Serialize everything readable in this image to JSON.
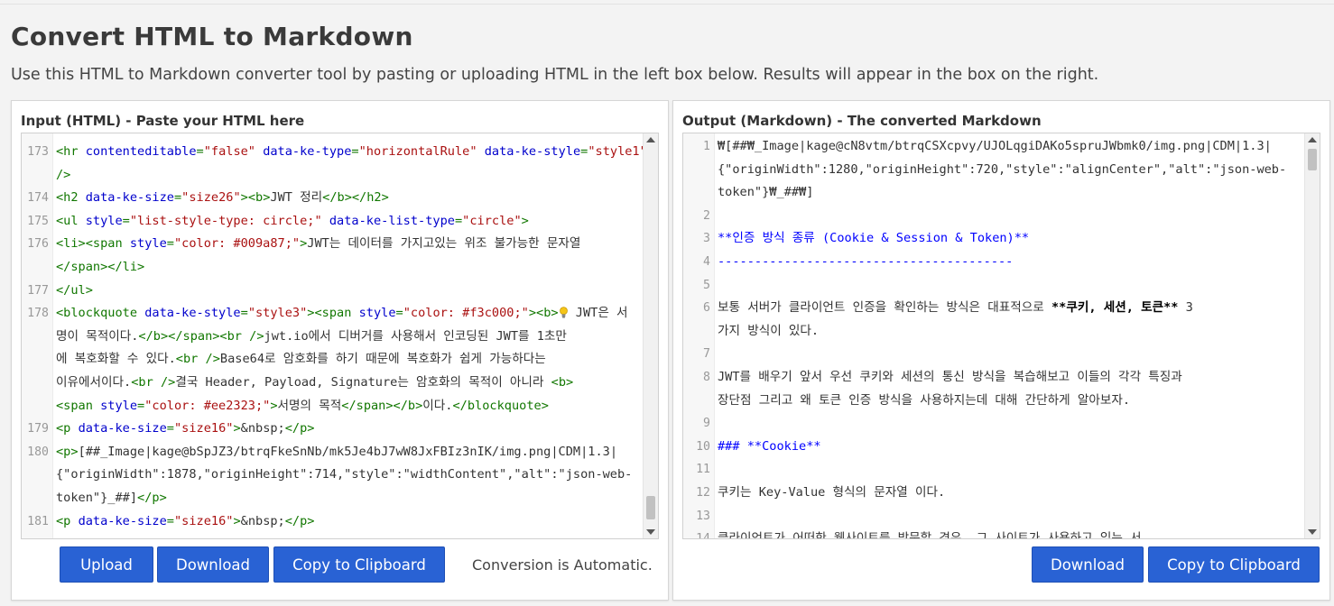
{
  "page": {
    "title": "Convert HTML to Markdown",
    "description": "Use this HTML to Markdown converter tool by pasting or uploading HTML in the left box below. Results will appear in the box on the right."
  },
  "input_panel": {
    "title": "Input (HTML) - Paste your HTML here",
    "lines": [
      {
        "n": "173",
        "rows": [
          [
            [
              "tag",
              "<hr "
            ],
            [
              "attr",
              "contenteditable"
            ],
            [
              "tag",
              "="
            ],
            [
              "str",
              "\"false\""
            ],
            [
              "tag",
              " "
            ],
            [
              "attr",
              "data-ke-type"
            ],
            [
              "tag",
              "="
            ],
            [
              "str",
              "\"horizontalRule\""
            ],
            [
              "tag",
              " "
            ],
            [
              "attr",
              "data-ke-style"
            ],
            [
              "tag",
              "="
            ],
            [
              "str",
              "\"style1\""
            ]
          ],
          [
            [
              "tag",
              "/>"
            ]
          ]
        ]
      },
      {
        "n": "174",
        "rows": [
          [
            [
              "tag",
              "<h2 "
            ],
            [
              "attr",
              "data-ke-size"
            ],
            [
              "tag",
              "="
            ],
            [
              "str",
              "\"size26\""
            ],
            [
              "tag",
              "><b>"
            ],
            [
              "txt",
              "JWT 정리"
            ],
            [
              "tag",
              "</b></h2>"
            ]
          ]
        ]
      },
      {
        "n": "175",
        "rows": [
          [
            [
              "tag",
              "<ul "
            ],
            [
              "attr",
              "style"
            ],
            [
              "tag",
              "="
            ],
            [
              "str",
              "\"list-style-type: circle;\""
            ],
            [
              "tag",
              " "
            ],
            [
              "attr",
              "data-ke-list-type"
            ],
            [
              "tag",
              "="
            ],
            [
              "str",
              "\"circle\""
            ],
            [
              "tag",
              ">"
            ]
          ]
        ]
      },
      {
        "n": "176",
        "rows": [
          [
            [
              "tag",
              "<li><span "
            ],
            [
              "attr",
              "style"
            ],
            [
              "tag",
              "="
            ],
            [
              "str",
              "\"color: #009a87;\""
            ],
            [
              "tag",
              ">"
            ],
            [
              "txt",
              "JWT는 데이터를 가지고있는 위조 불가능한 문자열"
            ]
          ],
          [
            [
              "tag",
              "</span></li>"
            ]
          ]
        ]
      },
      {
        "n": "177",
        "rows": [
          [
            [
              "tag",
              "</ul>"
            ]
          ]
        ]
      },
      {
        "n": "178",
        "rows": [
          [
            [
              "tag",
              "<blockquote "
            ],
            [
              "attr",
              "data-ke-style"
            ],
            [
              "tag",
              "="
            ],
            [
              "str",
              "\"style3\""
            ],
            [
              "tag",
              "><span "
            ],
            [
              "attr",
              "style"
            ],
            [
              "tag",
              "="
            ],
            [
              "str",
              "\"color: #f3c000;\""
            ],
            [
              "tag",
              "><b>"
            ],
            [
              "bulb",
              ""
            ],
            [
              "txt",
              " JWT은 서"
            ]
          ],
          [
            [
              "txt",
              "명이 목적이다."
            ],
            [
              "tag",
              "</b></span><br />"
            ],
            [
              "txt",
              "jwt.io에서 디버거를 사용해서 인코딩된 JWT를 1초만"
            ]
          ],
          [
            [
              "txt",
              "에 복호화할 수 있다."
            ],
            [
              "tag",
              "<br />"
            ],
            [
              "txt",
              "Base64로 암호화를 하기 때문에 복호화가 쉽게 가능하다는"
            ]
          ],
          [
            [
              "txt",
              "이유에서이다."
            ],
            [
              "tag",
              "<br />"
            ],
            [
              "txt",
              "결국 Header, Payload, Signature는 암호화의 목적이 아니라 "
            ],
            [
              "tag",
              "<b>"
            ]
          ],
          [
            [
              "tag",
              "<span "
            ],
            [
              "attr",
              "style"
            ],
            [
              "tag",
              "="
            ],
            [
              "str",
              "\"color: #ee2323;\""
            ],
            [
              "tag",
              ">"
            ],
            [
              "txt",
              "서명의 목적"
            ],
            [
              "tag",
              "</span></b>"
            ],
            [
              "txt",
              "이다."
            ],
            [
              "tag",
              "</blockquote>"
            ]
          ]
        ]
      },
      {
        "n": "179",
        "rows": [
          [
            [
              "tag",
              "<p "
            ],
            [
              "attr",
              "data-ke-size"
            ],
            [
              "tag",
              "="
            ],
            [
              "str",
              "\"size16\""
            ],
            [
              "tag",
              ">"
            ],
            [
              "txt",
              "&nbsp;"
            ],
            [
              "tag",
              "</p>"
            ]
          ]
        ]
      },
      {
        "n": "180",
        "rows": [
          [
            [
              "tag",
              "<p>"
            ],
            [
              "txt",
              "[##_Image|kage@bSpJZ3/btrqFkeSnNb/mk5Je4bJ7wW8JxFBIz3nIK/img.png|CDM|1.3|"
            ]
          ],
          [
            [
              "txt",
              "{\"originWidth\":1878,\"originHeight\":714,\"style\":\"widthContent\",\"alt\":\"json-web-"
            ]
          ],
          [
            [
              "txt",
              "token\"}_##]"
            ],
            [
              "tag",
              "</p>"
            ]
          ]
        ]
      },
      {
        "n": "181",
        "rows": [
          [
            [
              "tag",
              "<p "
            ],
            [
              "attr",
              "data-ke-size"
            ],
            [
              "tag",
              "="
            ],
            [
              "str",
              "\"size16\""
            ],
            [
              "tag",
              ">"
            ],
            [
              "txt",
              "&nbsp;"
            ],
            [
              "tag",
              "</p>"
            ]
          ]
        ]
      }
    ],
    "buttons": {
      "upload": "Upload",
      "download": "Download",
      "copy": "Copy to Clipboard"
    },
    "note": "Conversion is Automatic."
  },
  "output_panel": {
    "title": "Output (Markdown) - The converted Markdown",
    "lines": [
      {
        "n": "1",
        "rows": [
          [
            [
              "txt",
              "₩[##₩_Image|kage@cN8vtm/btrqCSXcpvy/UJOLqgiDAKo5spruJWbmk0/img.png|CDM|1.3|"
            ]
          ],
          [
            [
              "txt",
              "{\"originWidth\":1280,\"originHeight\":720,\"style\":\"alignCenter\",\"alt\":\"json-web-"
            ]
          ],
          [
            [
              "txt",
              "token\"}₩_##₩]"
            ]
          ]
        ]
      },
      {
        "n": "2",
        "rows": [
          [
            [
              "txt",
              ""
            ]
          ]
        ]
      },
      {
        "n": "3",
        "rows": [
          [
            [
              "mdh",
              "**인증 방식 종류 (Cookie & Session & Token)**"
            ]
          ]
        ]
      },
      {
        "n": "4",
        "rows": [
          [
            [
              "mdhr",
              "----------------------------------------"
            ]
          ]
        ]
      },
      {
        "n": "5",
        "rows": [
          [
            [
              "txt",
              ""
            ]
          ]
        ]
      },
      {
        "n": "6",
        "rows": [
          [
            [
              "txt",
              "보통 서버가 클라이언트 인증을 확인하는 방식은 대표적으로 "
            ],
            [
              "mdb",
              "**쿠키, 세션, 토큰**"
            ],
            [
              "txt",
              " 3"
            ]
          ],
          [
            [
              "txt",
              "가지 방식이 있다."
            ]
          ]
        ]
      },
      {
        "n": "7",
        "rows": [
          [
            [
              "txt",
              ""
            ]
          ]
        ]
      },
      {
        "n": "8",
        "rows": [
          [
            [
              "txt",
              "JWT를 배우기 앞서 우선 쿠키와 세션의 통신 방식을 복습해보고 이들의 각각 특징과"
            ]
          ],
          [
            [
              "txt",
              "장단점 그리고 왜 토큰 인증 방식을 사용하지는데 대해 간단하게 알아보자."
            ]
          ]
        ]
      },
      {
        "n": "9",
        "rows": [
          [
            [
              "txt",
              ""
            ]
          ]
        ]
      },
      {
        "n": "10",
        "rows": [
          [
            [
              "mdh",
              "### **Cookie**"
            ]
          ]
        ]
      },
      {
        "n": "11",
        "rows": [
          [
            [
              "txt",
              ""
            ]
          ]
        ]
      },
      {
        "n": "12",
        "rows": [
          [
            [
              "txt",
              "쿠키는 Key-Value 형식의 문자열 이다."
            ]
          ]
        ]
      },
      {
        "n": "13",
        "rows": [
          [
            [
              "txt",
              ""
            ]
          ]
        ]
      },
      {
        "n": "14",
        "rows": [
          [
            [
              "txt",
              "클라이언트가 어떠한 웹사이트를 방문할 경우, 그 사이트가 사용하고 있는 서"
            ]
          ]
        ]
      }
    ],
    "buttons": {
      "download": "Download",
      "copy": "Copy to Clipboard"
    }
  },
  "colors": {
    "button_bg": "#2962d4",
    "html_tag": "#117700",
    "html_attr": "#0000cc",
    "html_string": "#aa1111",
    "md_heading": "#0000ff"
  }
}
